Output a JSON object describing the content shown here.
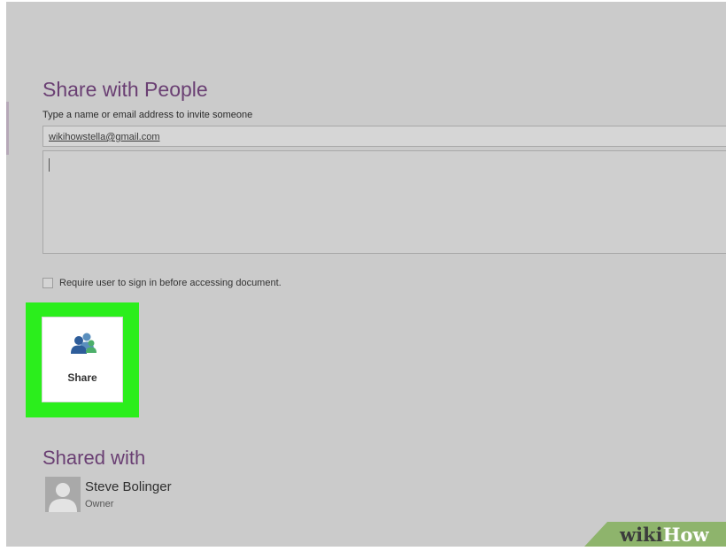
{
  "dialog": {
    "title": "Share with People",
    "invite_hint": "Type a name or email address to invite someone",
    "email_value": "wikihowstella@gmail.com",
    "message_value": "",
    "require_signin_label": "Require user to sign in before accessing document.",
    "require_signin_checked": false,
    "share_button_label": "Share",
    "share_icon": "people-icon"
  },
  "shared_with": {
    "title": "Shared with",
    "users": [
      {
        "name": "Steve Bolinger",
        "role": "Owner",
        "avatar_icon": "person-silhouette-icon"
      }
    ]
  },
  "highlight_color": "#2bee1c",
  "accent_color": "#6a3f73",
  "watermark": {
    "part1": "wiki",
    "part2": "How",
    "color": "#8eb46c"
  }
}
